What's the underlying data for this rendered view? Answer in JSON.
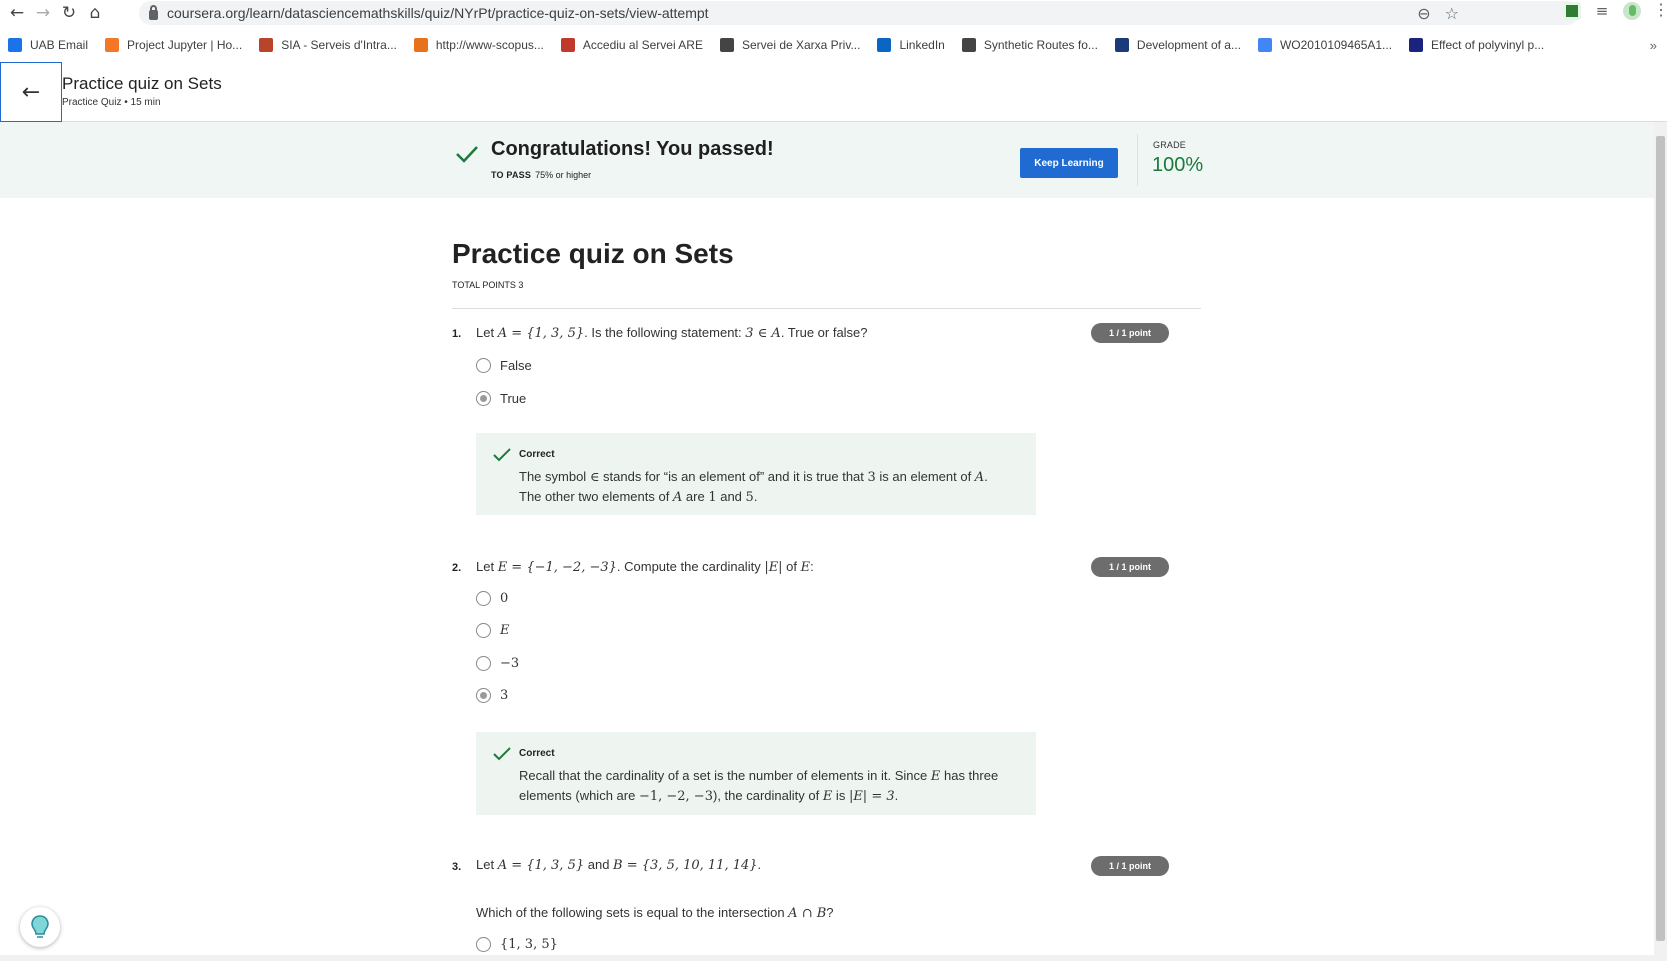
{
  "browser": {
    "url": "coursera.org/learn/datasciencemathskills/quiz/NYrPt/practice-quiz-on-sets/view-attempt",
    "bookmarks": [
      {
        "label": "UAB Email",
        "icon": "mail-icon",
        "color": "#1a73e8"
      },
      {
        "label": "Project Jupyter | Ho...",
        "icon": "jupyter-icon",
        "color": "#f37726"
      },
      {
        "label": "SIA - Serveis d'Intra...",
        "icon": "sia-icon",
        "color": "#b8442a"
      },
      {
        "label": "http://www-scopus...",
        "icon": "scopus-icon",
        "color": "#e9711c"
      },
      {
        "label": "Accediu al Servei ARE",
        "icon": "are-icon",
        "color": "#c0392b"
      },
      {
        "label": "Servei de Xarxa Priv...",
        "icon": "globe-icon",
        "color": "#444444"
      },
      {
        "label": "LinkedIn",
        "icon": "linkedin-icon",
        "color": "#0a66c2"
      },
      {
        "label": "Synthetic Routes fo...",
        "icon": "globe-icon",
        "color": "#444444"
      },
      {
        "label": "Development of a...",
        "icon": "ds-icon",
        "color": "#1a3a7a"
      },
      {
        "label": "WO2010109465A1...",
        "icon": "google-icon",
        "color": "#4285f4"
      },
      {
        "label": "Effect of polyvinyl p...",
        "icon": "scholar-icon",
        "color": "#1a237e"
      }
    ],
    "more": "»"
  },
  "header": {
    "title": "Practice quiz on Sets",
    "subtitle": "Practice Quiz • 15 min"
  },
  "banner": {
    "message": "Congratulations! You passed!",
    "to_pass_label": "TO PASS",
    "to_pass_value": "75% or higher",
    "keep_learning": "Keep Learning",
    "grade_label": "GRADE",
    "grade_value": "100%",
    "accent": "#1b7a3b",
    "button_color": "#1f6bd1"
  },
  "quiz": {
    "title": "Practice quiz on Sets",
    "total_points": "TOTAL POINTS 3",
    "questions": [
      {
        "number": "1.",
        "badge": "1 / 1 point",
        "text_a": "Let ",
        "math_a": "A = {1, 3, 5}",
        "text_b": ". Is the following statement: ",
        "math_b": "3 ∈ A",
        "text_c": ". True or false?",
        "options": [
          {
            "label": "False",
            "selected": false
          },
          {
            "label": "True",
            "selected": true
          }
        ],
        "feedback_title": "Correct",
        "feedback_line1_a": "The symbol ",
        "feedback_line1_sym": "∈",
        "feedback_line1_b": " stands for “is an element of” and it is true that ",
        "feedback_line1_n": "3",
        "feedback_line1_c": " is an element of ",
        "feedback_line1_v": "A",
        "feedback_line1_d": ".",
        "feedback_line2_a": "The other two elements of ",
        "feedback_line2_v": "A",
        "feedback_line2_b": " are ",
        "feedback_line2_n1": "1",
        "feedback_line2_c": " and ",
        "feedback_line2_n2": "5",
        "feedback_line2_d": "."
      },
      {
        "number": "2.",
        "badge": "1 / 1 point",
        "text_a": "Let ",
        "math_a": "E = {−1, −2, −3}",
        "text_b": ". Compute the cardinality ",
        "math_b": "|E|",
        "text_c": " of ",
        "math_c": "E",
        "text_d": ":",
        "options": [
          {
            "label": "0",
            "selected": false
          },
          {
            "label": "E",
            "selected": false
          },
          {
            "label": "−3",
            "selected": false
          },
          {
            "label": "3",
            "selected": true
          }
        ],
        "feedback_title": "Correct",
        "feedback_line1_a": "Recall that the cardinality of a set is the number of elements in it. Since ",
        "feedback_line1_v": "E",
        "feedback_line1_b": " has three",
        "feedback_line2_a": "elements (which are ",
        "feedback_line2_m": "−1, −2, −3",
        "feedback_line2_b": "), the cardinality of ",
        "feedback_line2_v": "E",
        "feedback_line2_c": " is ",
        "feedback_line2_m2": "|E| = 3",
        "feedback_line2_d": "."
      },
      {
        "number": "3.",
        "badge": "1 / 1 point",
        "text_a": "Let ",
        "math_a": "A = {1, 3, 5}",
        "text_b": " and ",
        "math_b": "B = {3, 5, 10, 11, 14}",
        "text_c": ".",
        "prompt_a": "Which of the following sets is equal to the intersection ",
        "prompt_math": "A ∩ B",
        "prompt_b": "?",
        "options": [
          {
            "label": "{1, 3, 5}",
            "selected": false
          }
        ]
      }
    ]
  }
}
